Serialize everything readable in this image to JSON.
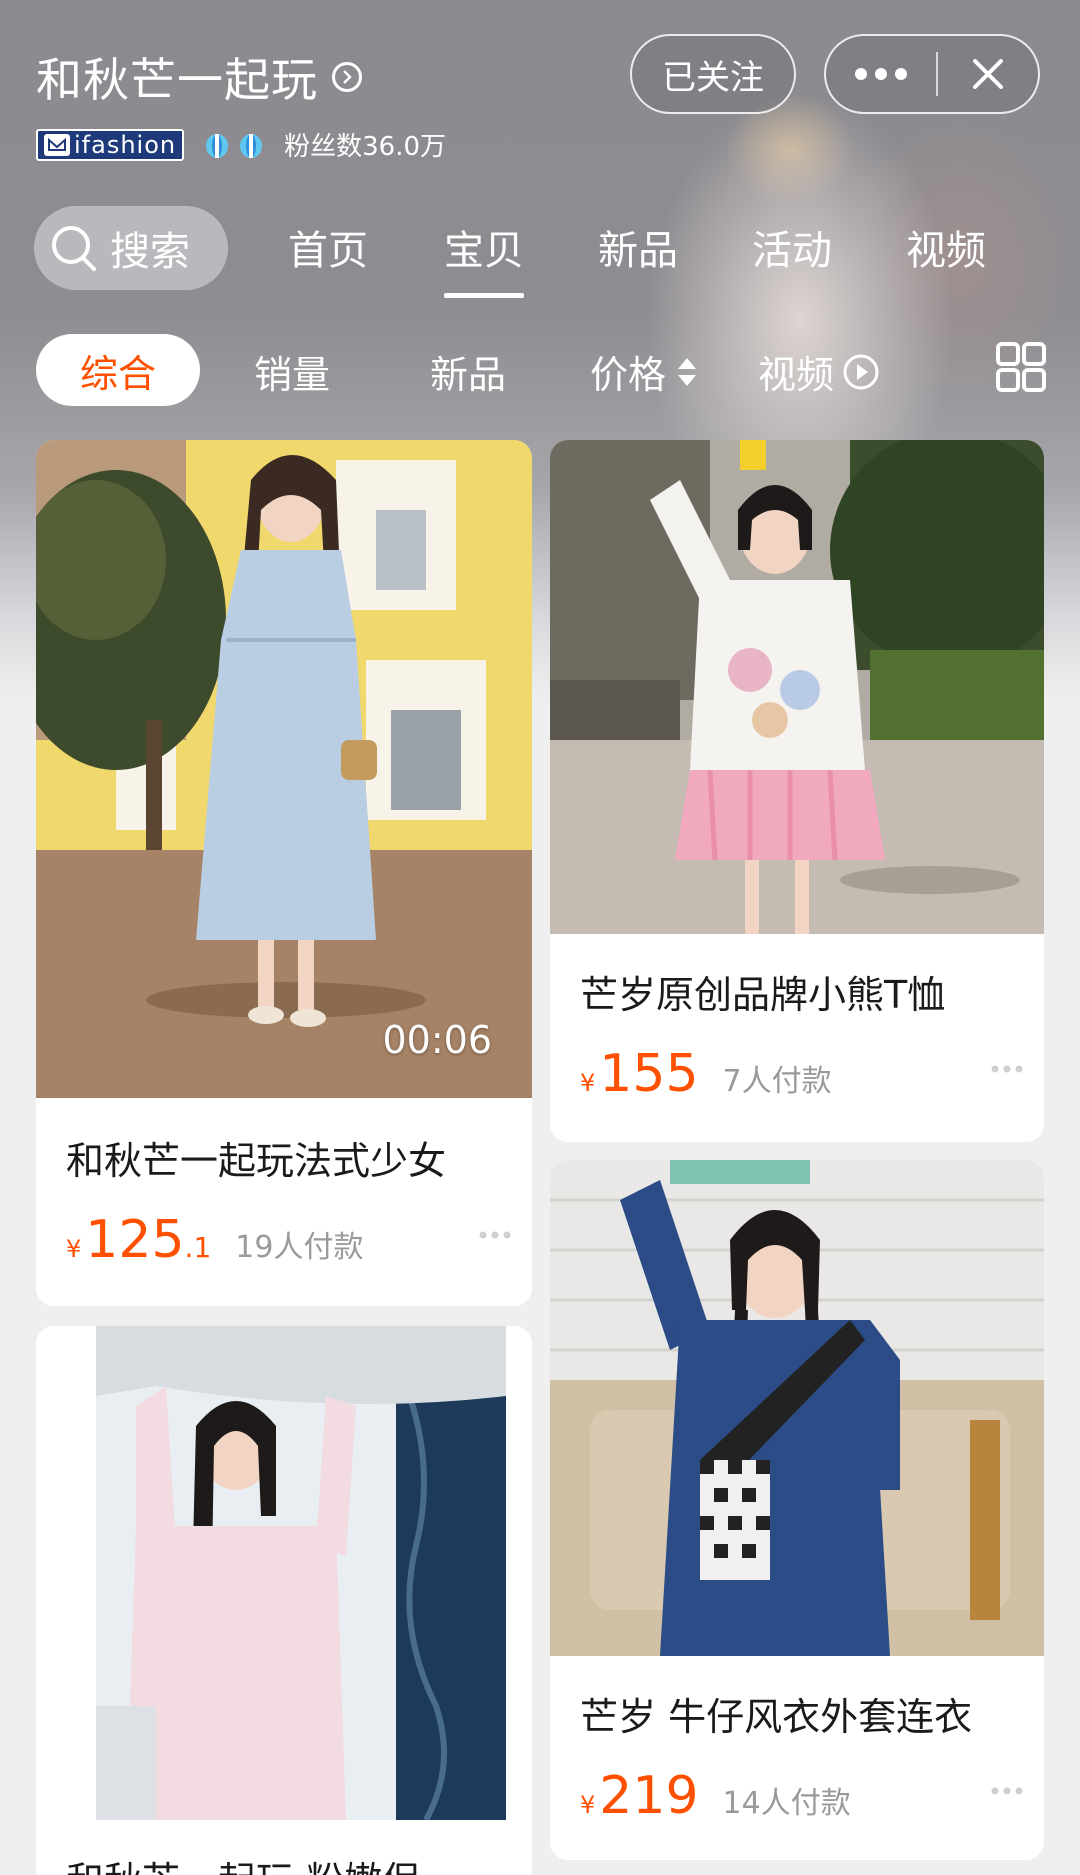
{
  "shop": {
    "name": "和秋芒一起玩",
    "badge_text": "ifashion",
    "fans": "粉丝数36.0万",
    "follow_label": "已关注"
  },
  "nav": {
    "search_label": "搜索",
    "tabs": [
      {
        "label": "首页"
      },
      {
        "label": "宝贝",
        "active": true
      },
      {
        "label": "新品"
      },
      {
        "label": "活动"
      },
      {
        "label": "视频"
      }
    ]
  },
  "sort": {
    "items": [
      {
        "label": "综合",
        "active": true
      },
      {
        "label": "销量"
      },
      {
        "label": "新品"
      },
      {
        "label": "价格"
      },
      {
        "label": "视频"
      }
    ]
  },
  "products": [
    {
      "title": "和秋芒一起玩法式少女",
      "price_int": "125",
      "price_dec": ".1",
      "buyers": "19人付款",
      "video_duration": "00:06"
    },
    {
      "title": "芒岁原创品牌小熊T恤",
      "price_int": "155",
      "price_dec": "",
      "buyers": "7人付款"
    },
    {
      "title": "和秋芒一起玩 粉嫩保",
      "price_int": "",
      "price_dec": "",
      "buyers": ""
    },
    {
      "title": "芒岁 牛仔风衣外套连衣",
      "price_int": "219",
      "price_dec": "",
      "buyers": "14人付款"
    }
  ],
  "currency_symbol": "¥",
  "colors": {
    "accent": "#ff5000",
    "header_bg": "#8c8a8f",
    "page_bg": "#efefef"
  }
}
